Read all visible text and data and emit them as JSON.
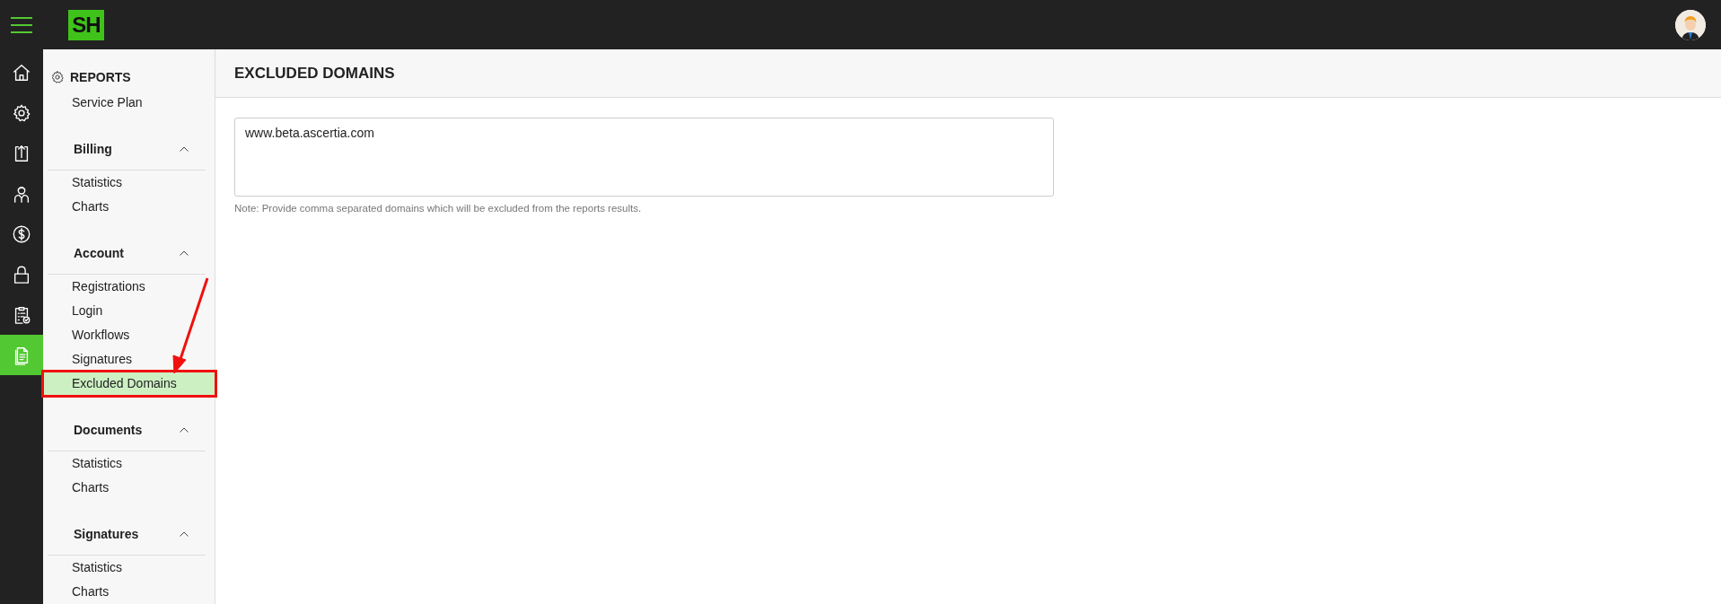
{
  "top_bar": {
    "logo": "SH"
  },
  "rail": [
    {
      "selected": false
    },
    {
      "selected": false
    },
    {
      "selected": false
    },
    {
      "selected": false
    },
    {
      "selected": false
    },
    {
      "selected": false
    },
    {
      "selected": false
    },
    {
      "selected": true
    }
  ],
  "sidebar": {
    "title": "REPORTS",
    "items": [
      {
        "label": "Service Plan",
        "selected": false
      }
    ],
    "groups": [
      {
        "title": "Billing",
        "expanded": true,
        "items": [
          {
            "label": "Statistics",
            "selected": false,
            "annotated": false
          },
          {
            "label": "Charts",
            "selected": false,
            "annotated": false
          }
        ]
      },
      {
        "title": "Account",
        "expanded": true,
        "items": [
          {
            "label": "Registrations",
            "selected": false,
            "annotated": false
          },
          {
            "label": "Login",
            "selected": false,
            "annotated": false
          },
          {
            "label": "Workflows",
            "selected": false,
            "annotated": false
          },
          {
            "label": "Signatures",
            "selected": false,
            "annotated": false
          },
          {
            "label": "Excluded Domains",
            "selected": true,
            "annotated": true
          }
        ]
      },
      {
        "title": "Documents",
        "expanded": true,
        "items": [
          {
            "label": "Statistics",
            "selected": false,
            "annotated": false
          },
          {
            "label": "Charts",
            "selected": false,
            "annotated": false
          }
        ]
      },
      {
        "title": "Signatures",
        "expanded": true,
        "items": [
          {
            "label": "Statistics",
            "selected": false,
            "annotated": false
          },
          {
            "label": "Charts",
            "selected": false,
            "annotated": false
          }
        ]
      }
    ]
  },
  "main": {
    "title": "EXCLUDED DOMAINS",
    "domains_field": {
      "value": "www.beta.ascertia.com"
    },
    "note": "Note: Provide comma separated domains which will be excluded from the reports results."
  }
}
